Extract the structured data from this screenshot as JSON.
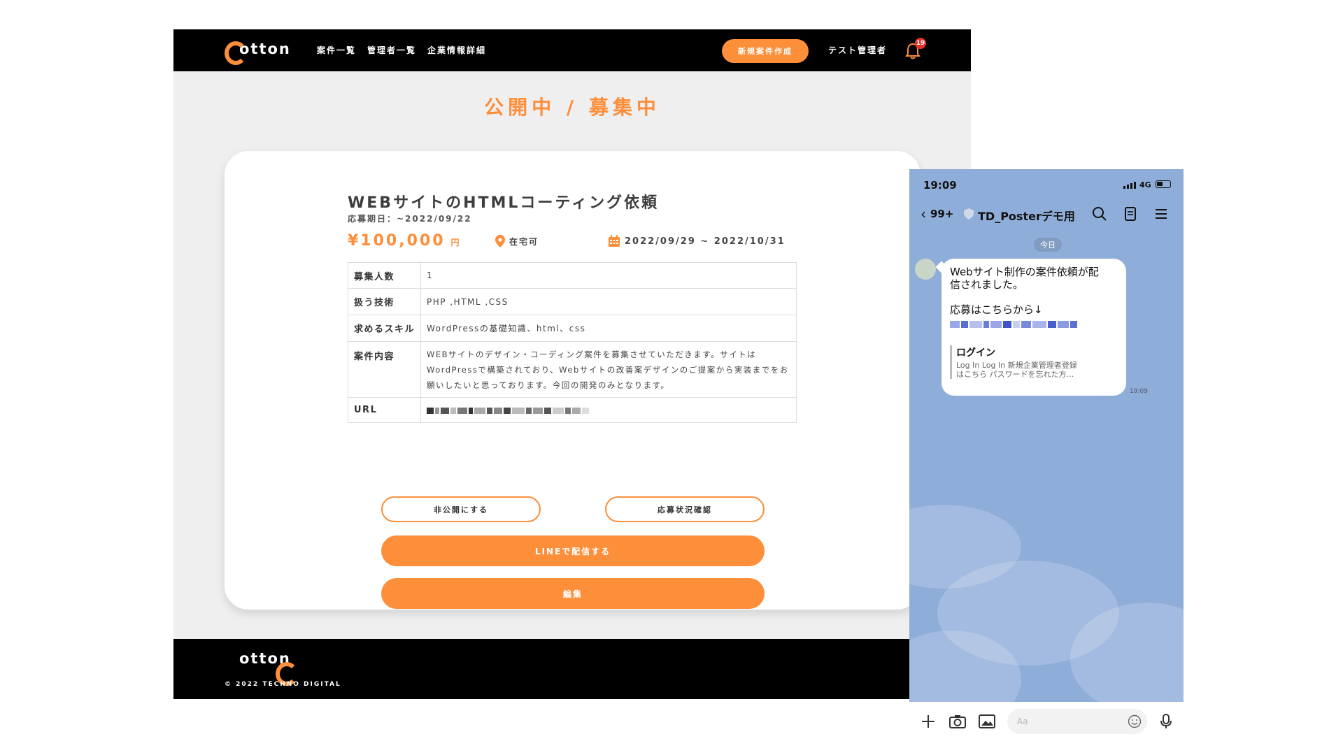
{
  "site": {
    "logo_text": "otton",
    "nav": [
      "案件一覧",
      "管理者一覧",
      "企業情報詳細"
    ],
    "new_button": "新規案件作成",
    "admin_name": "テスト管理者",
    "notification_count": "19",
    "page_title": "公開中 / 募集中",
    "job": {
      "title": "WEBサイトのHTMLコーティング依頼",
      "deadline": "応募期日：~2022/09/22",
      "price": "¥100,000",
      "price_unit": "円",
      "location": "在宅可",
      "period": "2022/09/29 ~ 2022/10/31"
    },
    "table": [
      {
        "label": "募集人数",
        "value": "1"
      },
      {
        "label": "扱う技術",
        "value": "PHP ,HTML ,CSS"
      },
      {
        "label": "求めるスキル",
        "value": "WordPressの基礎知識、html、css"
      },
      {
        "label": "案件内容",
        "value": "WEBサイトのデザイン・コーディング案件を募集させていただきます。サイトはWordPressで構築されており、Webサイトの改善案デザインのご提案から実装までをお願いしたいと思っております。今回の開発のみとなります。"
      },
      {
        "label": "URL",
        "value": ""
      }
    ],
    "buttons": {
      "unpublish": "非公開にする",
      "status": "応募状況確認",
      "line": "LINEで配信する",
      "edit": "編集"
    },
    "footer": {
      "logo_text": "otton",
      "copyright": "© 2022 TECHNO DIGITAL"
    },
    "accent_color": "#fd8e3a"
  },
  "phone": {
    "time": "19:09",
    "network": "4G",
    "unread": "99+",
    "chat_name": "TD_Posterデモ用",
    "date_label": "今日",
    "message": {
      "line1": "Webサイト制作の案件依頼が配",
      "line2": "信されました。",
      "line3": "応募はこちらから↓",
      "preview_title": "ログイン",
      "preview_desc1": "Log In Log In 新規企業管理者登録",
      "preview_desc2": "はこちら パスワードを忘れた方…",
      "time": "19:09"
    },
    "input_placeholder": "Aa",
    "background_color": "#8fadd9"
  }
}
